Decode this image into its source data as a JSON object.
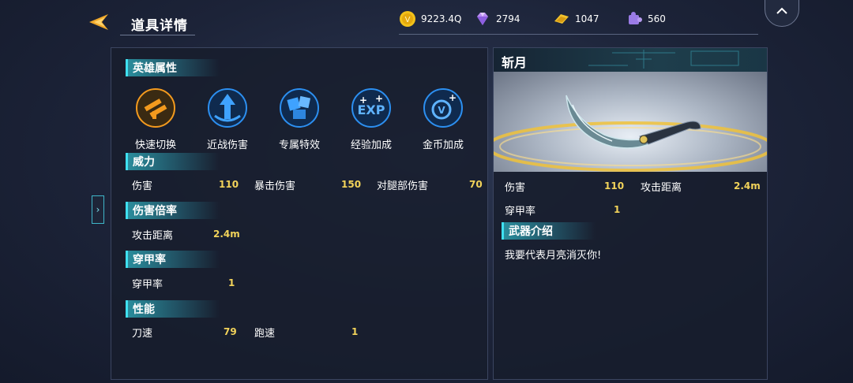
{
  "header": {
    "title": "道具详情"
  },
  "currencies": [
    {
      "icon": "gold-coin-icon",
      "value": "9223.4Q"
    },
    {
      "icon": "diamond-icon",
      "value": "2794"
    },
    {
      "icon": "gold-ticket-icon",
      "value": "1047"
    },
    {
      "icon": "puzzle-piece-icon",
      "value": "560"
    }
  ],
  "left": {
    "hero_attr_title": "英雄属性",
    "hero_attrs": [
      {
        "label": "快速切换",
        "icon": "weapon-swap-icon"
      },
      {
        "label": "近战伤害",
        "icon": "melee-arrow-icon"
      },
      {
        "label": "专属特效",
        "icon": "cubes-icon"
      },
      {
        "label": "经验加成",
        "icon": "exp-plus-icon"
      },
      {
        "label": "金币加成",
        "icon": "coin-plus-icon"
      }
    ],
    "power_title": "威力",
    "power": {
      "damage_label": "伤害",
      "damage_value": "110",
      "crit_label": "暴击伤害",
      "crit_value": "150",
      "leg_label": "对腿部伤害",
      "leg_value": "70"
    },
    "multiplier_title": "伤害倍率",
    "multiplier": {
      "range_label": "攻击距离",
      "range_value": "2.4m"
    },
    "armor_title": "穿甲率",
    "armor": {
      "label": "穿甲率",
      "value": "1"
    },
    "perf_title": "性能",
    "perf": {
      "blade_label": "刀速",
      "blade_value": "79",
      "run_label": "跑速",
      "run_value": "1"
    }
  },
  "right": {
    "weapon_name": "斩月",
    "stats": {
      "damage_label": "伤害",
      "damage_value": "110",
      "range_label": "攻击距离",
      "range_value": "2.4m",
      "armor_label": "穿甲率",
      "armor_value": "1"
    },
    "intro_title": "武器介绍",
    "intro_text": "我要代表月亮消灭你!"
  },
  "colors": {
    "accent": "#3fe0f0",
    "value": "#f2d35a",
    "icon_blue": "#1e7fd8",
    "icon_orange": "#f39a1e"
  }
}
